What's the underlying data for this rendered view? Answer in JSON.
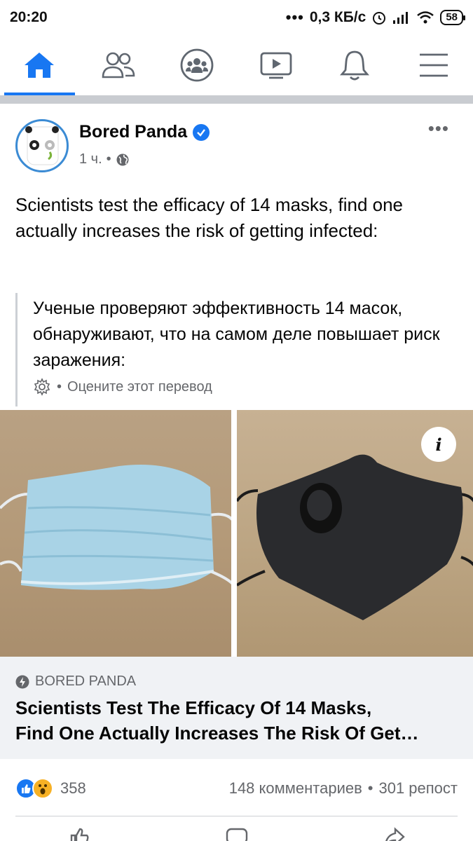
{
  "status_bar": {
    "time": "20:20",
    "network_speed": "0,3 КБ/с",
    "battery": "58"
  },
  "nav": {
    "items": [
      {
        "icon": "home-icon",
        "active": true
      },
      {
        "icon": "friends-icon",
        "active": false
      },
      {
        "icon": "groups-icon",
        "active": false
      },
      {
        "icon": "watch-icon",
        "active": false
      },
      {
        "icon": "notifications-icon",
        "active": false
      },
      {
        "icon": "menu-icon",
        "active": false
      }
    ]
  },
  "post": {
    "author": "Bored Panda",
    "verified": true,
    "time": "1 ч.",
    "privacy_icon": "globe-icon",
    "more_label": "•••",
    "text": "Scientists test the efficacy of 14 masks, find one actually increases the risk of getting infected:",
    "translation": {
      "text": "Ученые проверяют эффективность 14 масок, обнаруживают, что на самом деле повышает риск заражения:",
      "rate_label": "Оцените этот перевод"
    },
    "info_label": "i",
    "link": {
      "source": "BORED PANDA",
      "title_line1": "Scientists Test The Efficacy Of 14 Masks,",
      "title_line2": "Find One Actually Increases The Risk Of Get…"
    },
    "reactions": {
      "count": "358",
      "comments": "148 комментариев",
      "shares": "301 репост"
    }
  },
  "colors": {
    "accent": "#1877f2",
    "secondary_text": "#65676b",
    "link_bg": "#f0f2f5"
  }
}
